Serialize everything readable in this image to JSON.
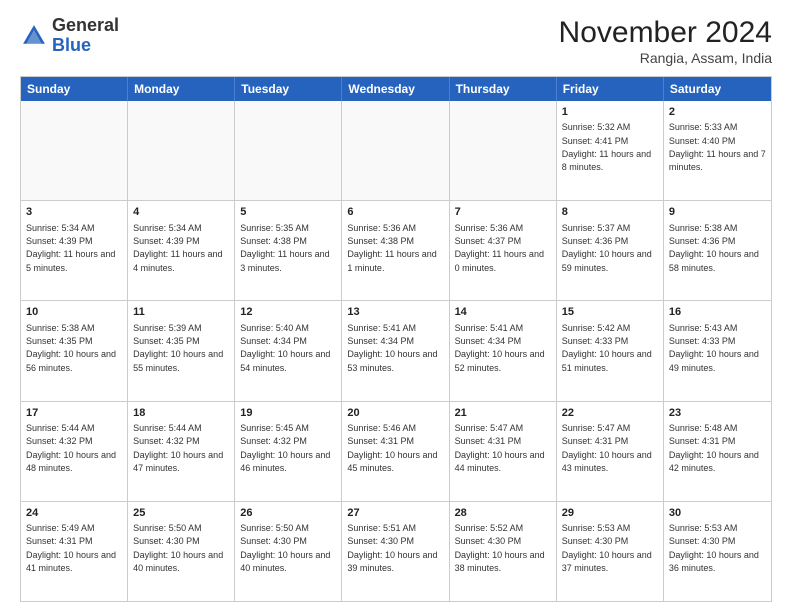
{
  "logo": {
    "general": "General",
    "blue": "Blue"
  },
  "header": {
    "month": "November 2024",
    "location": "Rangia, Assam, India"
  },
  "weekdays": [
    "Sunday",
    "Monday",
    "Tuesday",
    "Wednesday",
    "Thursday",
    "Friday",
    "Saturday"
  ],
  "rows": [
    [
      {
        "day": "",
        "text": ""
      },
      {
        "day": "",
        "text": ""
      },
      {
        "day": "",
        "text": ""
      },
      {
        "day": "",
        "text": ""
      },
      {
        "day": "",
        "text": ""
      },
      {
        "day": "1",
        "text": "Sunrise: 5:32 AM\nSunset: 4:41 PM\nDaylight: 11 hours and 8 minutes."
      },
      {
        "day": "2",
        "text": "Sunrise: 5:33 AM\nSunset: 4:40 PM\nDaylight: 11 hours and 7 minutes."
      }
    ],
    [
      {
        "day": "3",
        "text": "Sunrise: 5:34 AM\nSunset: 4:39 PM\nDaylight: 11 hours and 5 minutes."
      },
      {
        "day": "4",
        "text": "Sunrise: 5:34 AM\nSunset: 4:39 PM\nDaylight: 11 hours and 4 minutes."
      },
      {
        "day": "5",
        "text": "Sunrise: 5:35 AM\nSunset: 4:38 PM\nDaylight: 11 hours and 3 minutes."
      },
      {
        "day": "6",
        "text": "Sunrise: 5:36 AM\nSunset: 4:38 PM\nDaylight: 11 hours and 1 minute."
      },
      {
        "day": "7",
        "text": "Sunrise: 5:36 AM\nSunset: 4:37 PM\nDaylight: 11 hours and 0 minutes."
      },
      {
        "day": "8",
        "text": "Sunrise: 5:37 AM\nSunset: 4:36 PM\nDaylight: 10 hours and 59 minutes."
      },
      {
        "day": "9",
        "text": "Sunrise: 5:38 AM\nSunset: 4:36 PM\nDaylight: 10 hours and 58 minutes."
      }
    ],
    [
      {
        "day": "10",
        "text": "Sunrise: 5:38 AM\nSunset: 4:35 PM\nDaylight: 10 hours and 56 minutes."
      },
      {
        "day": "11",
        "text": "Sunrise: 5:39 AM\nSunset: 4:35 PM\nDaylight: 10 hours and 55 minutes."
      },
      {
        "day": "12",
        "text": "Sunrise: 5:40 AM\nSunset: 4:34 PM\nDaylight: 10 hours and 54 minutes."
      },
      {
        "day": "13",
        "text": "Sunrise: 5:41 AM\nSunset: 4:34 PM\nDaylight: 10 hours and 53 minutes."
      },
      {
        "day": "14",
        "text": "Sunrise: 5:41 AM\nSunset: 4:34 PM\nDaylight: 10 hours and 52 minutes."
      },
      {
        "day": "15",
        "text": "Sunrise: 5:42 AM\nSunset: 4:33 PM\nDaylight: 10 hours and 51 minutes."
      },
      {
        "day": "16",
        "text": "Sunrise: 5:43 AM\nSunset: 4:33 PM\nDaylight: 10 hours and 49 minutes."
      }
    ],
    [
      {
        "day": "17",
        "text": "Sunrise: 5:44 AM\nSunset: 4:32 PM\nDaylight: 10 hours and 48 minutes."
      },
      {
        "day": "18",
        "text": "Sunrise: 5:44 AM\nSunset: 4:32 PM\nDaylight: 10 hours and 47 minutes."
      },
      {
        "day": "19",
        "text": "Sunrise: 5:45 AM\nSunset: 4:32 PM\nDaylight: 10 hours and 46 minutes."
      },
      {
        "day": "20",
        "text": "Sunrise: 5:46 AM\nSunset: 4:31 PM\nDaylight: 10 hours and 45 minutes."
      },
      {
        "day": "21",
        "text": "Sunrise: 5:47 AM\nSunset: 4:31 PM\nDaylight: 10 hours and 44 minutes."
      },
      {
        "day": "22",
        "text": "Sunrise: 5:47 AM\nSunset: 4:31 PM\nDaylight: 10 hours and 43 minutes."
      },
      {
        "day": "23",
        "text": "Sunrise: 5:48 AM\nSunset: 4:31 PM\nDaylight: 10 hours and 42 minutes."
      }
    ],
    [
      {
        "day": "24",
        "text": "Sunrise: 5:49 AM\nSunset: 4:31 PM\nDaylight: 10 hours and 41 minutes."
      },
      {
        "day": "25",
        "text": "Sunrise: 5:50 AM\nSunset: 4:30 PM\nDaylight: 10 hours and 40 minutes."
      },
      {
        "day": "26",
        "text": "Sunrise: 5:50 AM\nSunset: 4:30 PM\nDaylight: 10 hours and 40 minutes."
      },
      {
        "day": "27",
        "text": "Sunrise: 5:51 AM\nSunset: 4:30 PM\nDaylight: 10 hours and 39 minutes."
      },
      {
        "day": "28",
        "text": "Sunrise: 5:52 AM\nSunset: 4:30 PM\nDaylight: 10 hours and 38 minutes."
      },
      {
        "day": "29",
        "text": "Sunrise: 5:53 AM\nSunset: 4:30 PM\nDaylight: 10 hours and 37 minutes."
      },
      {
        "day": "30",
        "text": "Sunrise: 5:53 AM\nSunset: 4:30 PM\nDaylight: 10 hours and 36 minutes."
      }
    ]
  ]
}
